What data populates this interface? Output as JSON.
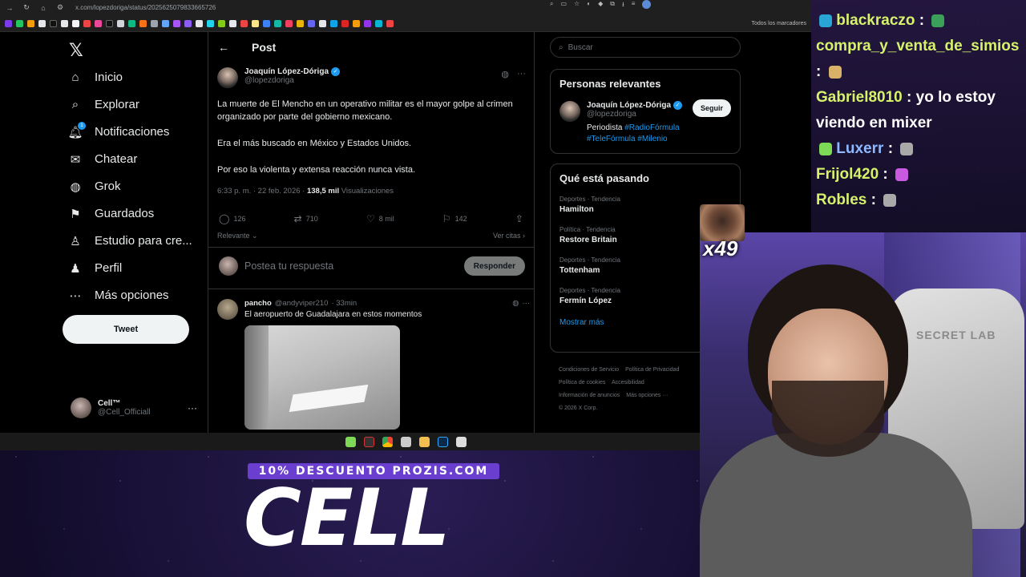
{
  "browser": {
    "url": "x.com/lopezdoriga/status/2025625079833665726",
    "bookmarks_folder": "Todos los marcadores"
  },
  "nav": {
    "items": [
      {
        "label": "Inicio",
        "icon": "home-icon"
      },
      {
        "label": "Explorar",
        "icon": "search-icon"
      },
      {
        "label": "Notificaciones",
        "icon": "bell-icon",
        "badge": "1"
      },
      {
        "label": "Chatear",
        "icon": "mail-icon"
      },
      {
        "label": "Grok",
        "icon": "grok-icon"
      },
      {
        "label": "Guardados",
        "icon": "bookmark-icon"
      },
      {
        "label": "Estudio para cre...",
        "icon": "studio-icon"
      },
      {
        "label": "Perfil",
        "icon": "person-icon"
      },
      {
        "label": "Más opciones",
        "icon": "more-circle-icon"
      }
    ],
    "tweet_button": "Tweet",
    "account": {
      "name": "Cell™",
      "handle": "@Cell_Officiall"
    }
  },
  "post": {
    "header": "Post",
    "author": {
      "name": "Joaquín López-Dóriga",
      "handle": "@lopezdoriga"
    },
    "body": [
      "La muerte de El Mencho en un operativo militar es el mayor golpe al crimen organizado por parte del gobierno mexicano.",
      "Era el más buscado en México y Estados Unidos.",
      "Por eso la violenta y extensa reacción nunca vista."
    ],
    "timestamp": "6:33 p. m. · 22 feb. 2026 ·",
    "views": "138,5 mil",
    "views_label": "Visualizaciones",
    "stats": {
      "replies": "126",
      "reposts": "710",
      "likes": "8 mil",
      "bookmarks": "142"
    },
    "sort_label": "Relevante",
    "quotes_label": "Ver citas",
    "reply_placeholder": "Postea tu respuesta",
    "reply_button": "Responder"
  },
  "reply": {
    "name": "pancho",
    "handle": "@andyviper210",
    "time": "· 33min",
    "text": "El aeropuerto de Guadalajara en estos momentos"
  },
  "sidebar": {
    "search_placeholder": "Buscar",
    "relevant_title": "Personas relevantes",
    "person": {
      "name": "Joaquín López-Dóriga",
      "handle": "@lopezdoriga",
      "bio_prefix": "Periodista",
      "tags": [
        "#RadioFórmula",
        "#TeleFórmula",
        "#Milenio"
      ],
      "follow_label": "Seguir"
    },
    "trending_title": "Qué está pasando",
    "trends": [
      {
        "category": "Deportes · Tendencia",
        "name": "Hamilton"
      },
      {
        "category": "Política · Tendencia",
        "name": "Restore Britain"
      },
      {
        "category": "Deportes · Tendencia",
        "name": "Tottenham"
      },
      {
        "category": "Deportes · Tendencia",
        "name": "Fermín López"
      }
    ],
    "show_more": "Mostrar más",
    "footer": [
      "Condiciones de Servicio",
      "Política de Privacidad",
      "Política de cookies",
      "Accesibilidad",
      "Información de anuncios",
      "Más opciones ···",
      "© 2026 X Corp."
    ]
  },
  "chat": [
    {
      "user": "blackraczo",
      "msg": " : ",
      "emote_color": "#3aa05a"
    },
    {
      "user": "compra_y_venta_de_simios",
      "msg": "",
      "emote_color": ""
    },
    {
      "user": "",
      "msg": ": ",
      "emote_color": "#d9b26a"
    },
    {
      "user": "Gabriel8010",
      "msg": " : yo lo estoy",
      "emote_color": ""
    },
    {
      "user": "",
      "msg": "viendo en mixer",
      "emote_color": ""
    },
    {
      "user": "Luxerr",
      "msg": " : ",
      "emote_color": "#a9a9a9"
    },
    {
      "user": "Frijol420",
      "msg": " : ",
      "emote_color": "#c85adf"
    },
    {
      "user": "Robles",
      "msg": " : ",
      "emote_color": "#a9a9a9"
    }
  ],
  "overlay": {
    "emote_count": "x49",
    "promo": "10% DESCUENTO PROZIS.COM",
    "brand": "CELL",
    "chair_brand": "SECRET LAB"
  },
  "colors": {
    "accent": "#1d9bf0",
    "chat_user": "#d6f26b",
    "promo_bg": "#6a3fd0"
  }
}
